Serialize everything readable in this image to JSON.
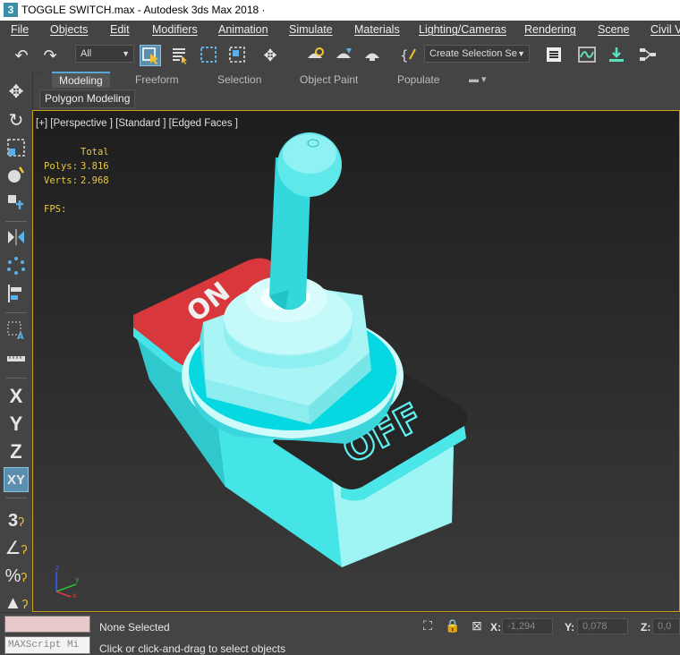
{
  "window": {
    "title": "TOGGLE SWITCH.max - Autodesk 3ds Max 2018 ·",
    "app_icon": "3"
  },
  "menu": [
    "File",
    "Objects",
    "Edit",
    "Modifiers",
    "Animation",
    "Simulate",
    "Materials",
    "Lighting/Cameras",
    "Rendering",
    "Scene",
    "Civil V"
  ],
  "toolbar": {
    "filter_value": "All",
    "selection_set_value": "Create Selection Se",
    "icons": [
      "undo-icon",
      "redo-icon",
      "select-object-icon",
      "select-by-name-icon",
      "rectangle-selection-icon",
      "window-crossing-icon",
      "move-icon",
      "render-setup-icon",
      "render-frame-icon",
      "render-production-icon",
      "edit-named-selection-icon",
      "layer-explorer-icon",
      "curve-editor-icon",
      "import-icon",
      "schematic-view-icon"
    ]
  },
  "ribbon": {
    "tabs": [
      "Modeling",
      "Freeform",
      "Selection",
      "Object Paint",
      "Populate"
    ],
    "active_tab": "Modeling",
    "sub_label": "Polygon Modeling"
  },
  "viewport": {
    "label": "[+] [Perspective ] [Standard ] [Edged Faces ]",
    "stats": {
      "total_label": "Total",
      "polys_label": "Polys:",
      "polys_value": "3.816",
      "verts_label": "Verts:",
      "verts_value": "2.968",
      "fps_label": "FPS:"
    },
    "model": {
      "on_text": "ON",
      "off_text": "OFF"
    },
    "axis": {
      "x": "x",
      "y": "y",
      "z": "z"
    }
  },
  "left_panel": {
    "icons": [
      "move-icon",
      "rotate-icon",
      "scale-icon",
      "place-icon",
      "pivot-icon",
      "mirror-icon",
      "array-icon",
      "align-icon",
      "snap-label-icon",
      "measure-icon"
    ],
    "axes": [
      "X",
      "Y",
      "Z",
      "XY"
    ],
    "snaps": [
      "3",
      "∠",
      "%",
      "▲"
    ]
  },
  "status": {
    "selection": "None Selected",
    "prompt": "Click or click-and-drag to select objects",
    "maxscript": "MAXScript Mi",
    "x_label": "X:",
    "x_value": "-1,294",
    "y_label": "Y:",
    "y_value": "0,078",
    "z_label": "Z:",
    "z_value": "0,0"
  },
  "colors": {
    "cyan": "#3fe0e0",
    "cyan_dark": "#1fbfc4",
    "red": "#d8373b",
    "black_plate": "#262626",
    "selection_blue": "#5b8fb0",
    "viewport_border": "#c8a020"
  }
}
